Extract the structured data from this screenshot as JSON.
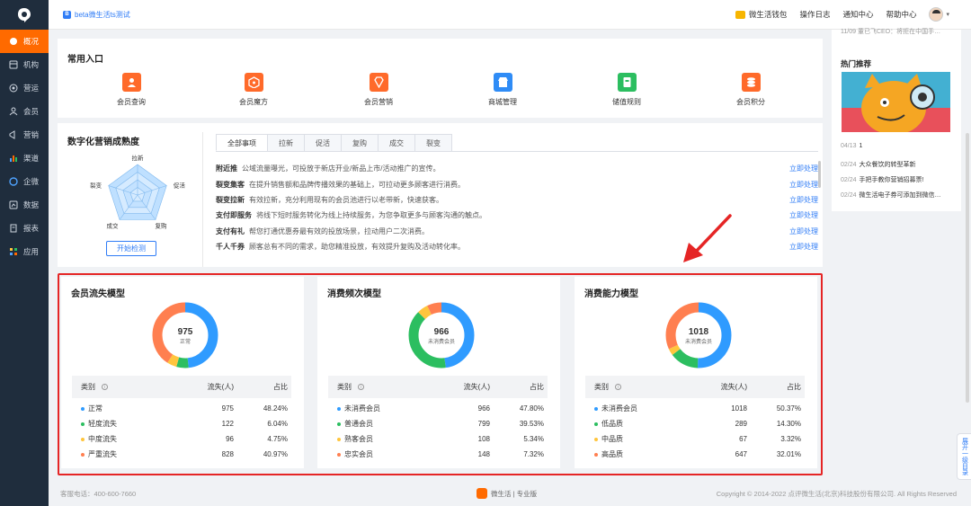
{
  "sidebar": {
    "items": [
      {
        "label": "概况",
        "icon": "dashboard-icon",
        "active": true
      },
      {
        "label": "机构",
        "icon": "building-icon"
      },
      {
        "label": "营运",
        "icon": "operations-icon"
      },
      {
        "label": "会员",
        "icon": "member-icon"
      },
      {
        "label": "营销",
        "icon": "megaphone-icon"
      },
      {
        "label": "渠道",
        "icon": "channel-icon"
      },
      {
        "label": "企微",
        "icon": "wecom-icon"
      },
      {
        "label": "数据",
        "icon": "data-icon"
      },
      {
        "label": "报表",
        "icon": "report-icon"
      },
      {
        "label": "应用",
        "icon": "apps-icon"
      }
    ]
  },
  "header": {
    "brand_badge": "B",
    "brand": "beta微生活ts测试",
    "wallet": "微生活钱包",
    "oplog": "操作日志",
    "notify": "通知中心",
    "help": "帮助中心"
  },
  "quick": {
    "title": "常用入口",
    "items": [
      {
        "label": "会员查询",
        "color": "#ff6a2a",
        "icon": "user-search-icon"
      },
      {
        "label": "会员魔方",
        "color": "#ff6a2a",
        "icon": "cube-icon"
      },
      {
        "label": "会员营销",
        "color": "#ff6a2a",
        "icon": "diamond-icon"
      },
      {
        "label": "商城管理",
        "color": "#2f8cf6",
        "icon": "store-icon"
      },
      {
        "label": "储值规则",
        "color": "#2cbe60",
        "icon": "wallet-card-icon"
      },
      {
        "label": "会员积分",
        "color": "#ff6a2a",
        "icon": "coins-icon"
      }
    ]
  },
  "maturity": {
    "title": "数字化营销成熟度",
    "radar_labels": [
      "拉新",
      "促活",
      "复购",
      "成交",
      "裂变"
    ],
    "start_label": "开始检测",
    "tabs": [
      "全部事项",
      "拉新",
      "促活",
      "复购",
      "成交",
      "裂变"
    ],
    "todos": [
      {
        "title": "附近推",
        "desc": "公域流量曝光，可投放于新店开业/新品上市/活动推广的宣传。",
        "link": "立即处理"
      },
      {
        "title": "裂变集客",
        "desc": "在提升销售额和品牌传播效果的基础上，可拉动更多顾客进行消费。",
        "link": "立即处理"
      },
      {
        "title": "裂变拉新",
        "desc": "有效拉新，充分利用现有的会员池进行以老带新，快速获客。",
        "link": "立即处理"
      },
      {
        "title": "支付即服务",
        "desc": "将线下短时服务转化为线上持续服务，为您争取更多与顾客沟通的触点。",
        "link": "立即处理"
      },
      {
        "title": "支付有礼",
        "desc": "帮您打通优惠券最有效的投放场景，拉动用户二次消费。",
        "link": "立即处理"
      },
      {
        "title": "千人千券",
        "desc": "顾客总有不同的需求，助您精准投放，有效提升复购及活动转化率。",
        "link": "立即处理"
      }
    ]
  },
  "models": [
    {
      "title": "会员流失模型",
      "center_value": "975",
      "center_label": "正常",
      "headers": [
        "类别",
        "流失(人)",
        "占比"
      ],
      "rows": [
        {
          "name": "正常",
          "count": "975",
          "pct": "48.24%",
          "value": 975,
          "color": "#2f9bff"
        },
        {
          "name": "轻度流失",
          "count": "122",
          "pct": "6.04%",
          "value": 122,
          "color": "#2cbe60"
        },
        {
          "name": "中度流失",
          "count": "96",
          "pct": "4.75%",
          "value": 96,
          "color": "#ffc53d"
        },
        {
          "name": "严重流失",
          "count": "828",
          "pct": "40.97%",
          "value": 828,
          "color": "#ff7f50"
        }
      ]
    },
    {
      "title": "消费频次模型",
      "center_value": "966",
      "center_label": "未消费会员",
      "headers": [
        "类别",
        "流失(人)",
        "占比"
      ],
      "rows": [
        {
          "name": "未消费会员",
          "count": "966",
          "pct": "47.80%",
          "value": 966,
          "color": "#2f9bff"
        },
        {
          "name": "普通会员",
          "count": "799",
          "pct": "39.53%",
          "value": 799,
          "color": "#2cbe60"
        },
        {
          "name": "熟客会员",
          "count": "108",
          "pct": "5.34%",
          "value": 108,
          "color": "#ffc53d"
        },
        {
          "name": "忠实会员",
          "count": "148",
          "pct": "7.32%",
          "value": 148,
          "color": "#ff7f50"
        }
      ]
    },
    {
      "title": "消费能力模型",
      "center_value": "1018",
      "center_label": "未消费会员",
      "headers": [
        "类别",
        "流失(人)",
        "占比"
      ],
      "rows": [
        {
          "name": "未消费会员",
          "count": "1018",
          "pct": "50.37%",
          "value": 1018,
          "color": "#2f9bff"
        },
        {
          "name": "低品质",
          "count": "289",
          "pct": "14.30%",
          "value": 289,
          "color": "#2cbe60"
        },
        {
          "name": "中品质",
          "count": "67",
          "pct": "3.32%",
          "value": 67,
          "color": "#ffc53d"
        },
        {
          "name": "高品质",
          "count": "647",
          "pct": "32.01%",
          "value": 647,
          "color": "#ff7f50"
        }
      ]
    }
  ],
  "right": {
    "top_news": "11/09  董已飞CEO：将拒在中国手…",
    "hot_title": "热门推荐",
    "news": [
      {
        "date": "04/13",
        "title": "1"
      },
      {
        "date": "02/24",
        "title": "大众餐饮的转型革新"
      },
      {
        "date": "02/24",
        "title": "手把手教你营销招募票!"
      },
      {
        "date": "02/24",
        "title": "微生活电子券可添加到微信…"
      }
    ]
  },
  "float_tab": "展开一级目录",
  "footer": {
    "phone": "客服电话：400-600-7660",
    "brand": "微生活 | 专业版",
    "copyright": "Copyright © 2014-2022 点评微生活(北京)科技股份有限公司. All Rights Reserved"
  },
  "accent": "#ff6a00"
}
